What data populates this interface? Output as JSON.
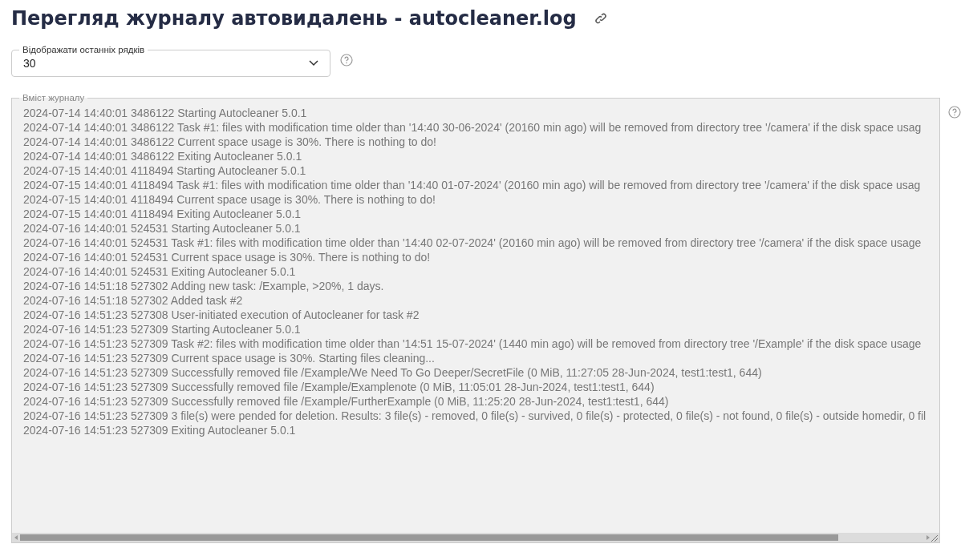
{
  "title": "Перегляд журналу автовидалень - autocleaner.log",
  "lines_select": {
    "label": "Відображати останніх рядків",
    "value": "30"
  },
  "log": {
    "label": "Вміст журналу",
    "lines": [
      "2024-07-14 14:40:01 3486122 Starting Autocleaner 5.0.1",
      "2024-07-14 14:40:01 3486122 Task #1: files with modification time older than '14:40 30-06-2024' (20160 min ago) will be removed from directory tree '/camera' if the disk space usag",
      "2024-07-14 14:40:01 3486122 Current space usage is 30%. There is nothing to do!",
      "2024-07-14 14:40:01 3486122 Exiting Autocleaner 5.0.1",
      "2024-07-15 14:40:01 4118494 Starting Autocleaner 5.0.1",
      "2024-07-15 14:40:01 4118494 Task #1: files with modification time older than '14:40 01-07-2024' (20160 min ago) will be removed from directory tree '/camera' if the disk space usag",
      "2024-07-15 14:40:01 4118494 Current space usage is 30%. There is nothing to do!",
      "2024-07-15 14:40:01 4118494 Exiting Autocleaner 5.0.1",
      "2024-07-16 14:40:01 524531 Starting Autocleaner 5.0.1",
      "2024-07-16 14:40:01 524531 Task #1: files with modification time older than '14:40 02-07-2024' (20160 min ago) will be removed from directory tree '/camera' if the disk space usage",
      "2024-07-16 14:40:01 524531 Current space usage is 30%. There is nothing to do!",
      "2024-07-16 14:40:01 524531 Exiting Autocleaner 5.0.1",
      "2024-07-16 14:51:18 527302 Adding new task: /Example, >20%, 1 days.",
      "2024-07-16 14:51:18 527302 Added task #2",
      "2024-07-16 14:51:23 527308 User-initiated execution of Autocleaner for task #2",
      "2024-07-16 14:51:23 527309 Starting Autocleaner 5.0.1",
      "2024-07-16 14:51:23 527309 Task #2: files with modification time older than '14:51 15-07-2024' (1440 min ago) will be removed from directory tree '/Example' if the disk space usage",
      "2024-07-16 14:51:23 527309 Current space usage is 30%. Starting files cleaning...",
      "2024-07-16 14:51:23 527309 Successfully removed file /Example/We Need To Go Deeper/SecretFile (0 MiB, 11:27:05 28-Jun-2024, test1:test1, 644)",
      "2024-07-16 14:51:23 527309 Successfully removed file /Example/Examplenote (0 MiB, 11:05:01 28-Jun-2024, test1:test1, 644)",
      "2024-07-16 14:51:23 527309 Successfully removed file /Example/FurtherExample (0 MiB, 11:25:20 28-Jun-2024, test1:test1, 644)",
      "2024-07-16 14:51:23 527309 3 file(s) were pended for deletion. Results: 3 file(s) - removed, 0 file(s) - survived, 0 file(s) - protected, 0 file(s) - not found, 0 file(s) - outside homedir, 0 fil",
      "2024-07-16 14:51:23 527309 Exiting Autocleaner 5.0.1"
    ]
  }
}
